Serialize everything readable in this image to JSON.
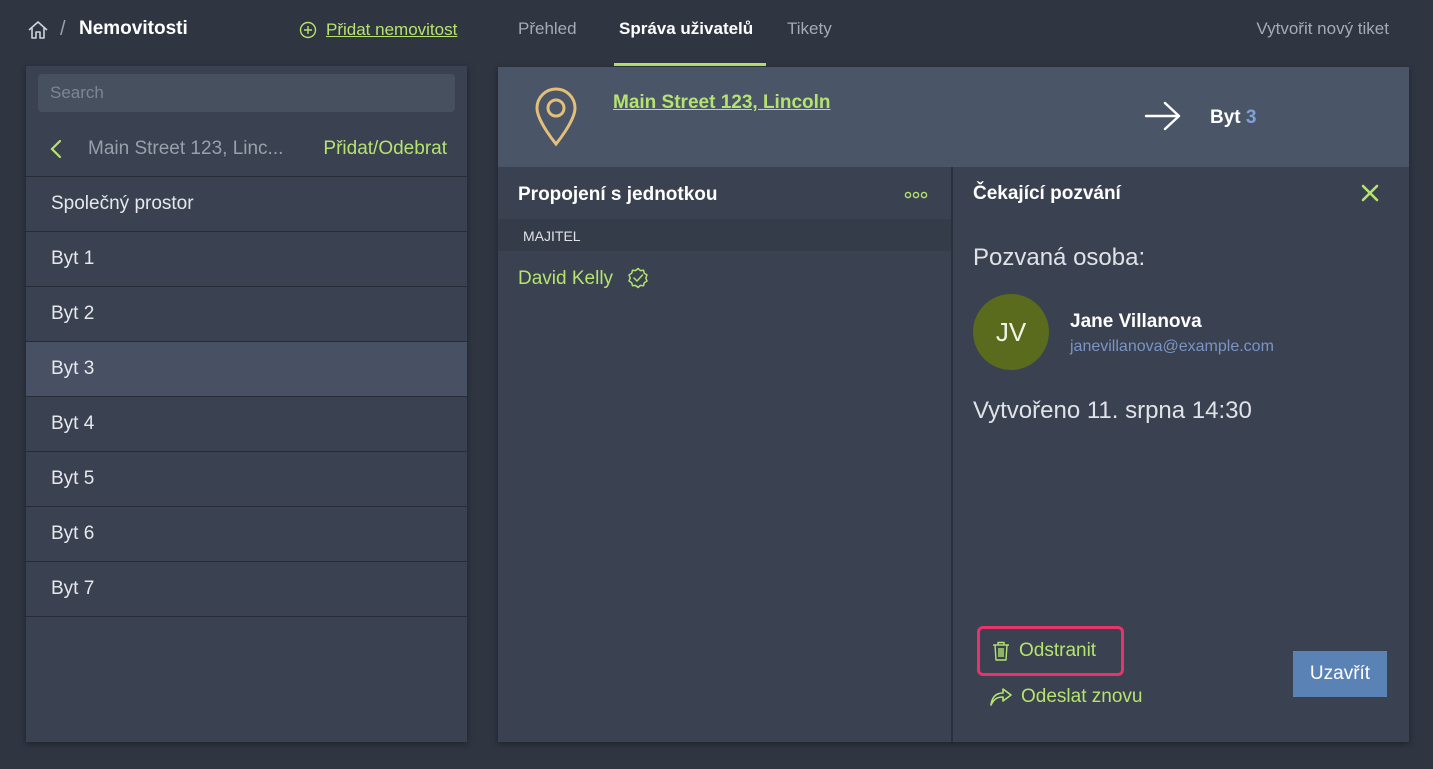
{
  "topbar": {
    "breadcrumb_separator": "/",
    "section_title": "Nemovitosti",
    "add_property_label": "Přidat nemovitost",
    "tabs": [
      {
        "label": "Přehled",
        "active": false
      },
      {
        "label": "Správa uživatelů",
        "active": true
      },
      {
        "label": "Tikety",
        "active": false
      }
    ],
    "new_ticket_label": "Vytvořit nový tiket"
  },
  "sidebar": {
    "search_placeholder": "Search",
    "address_truncated": "Main Street 123, Linc...",
    "add_remove_label": "Přidat/Odebrat",
    "units": [
      {
        "label": "Společný prostor",
        "selected": false
      },
      {
        "label": "Byt 1",
        "selected": false
      },
      {
        "label": "Byt 2",
        "selected": false
      },
      {
        "label": "Byt 3",
        "selected": true
      },
      {
        "label": "Byt 4",
        "selected": false
      },
      {
        "label": "Byt 5",
        "selected": false
      },
      {
        "label": "Byt 6",
        "selected": false
      },
      {
        "label": "Byt 7",
        "selected": false
      }
    ]
  },
  "main": {
    "address": "Main Street 123, Lincoln",
    "unit_word": "Byt",
    "unit_number": "3",
    "connection": {
      "title": "Propojení s jednotkou",
      "owner_section_label": "MAJITEL",
      "owner_name": "David Kelly"
    },
    "invite": {
      "title": "Čekající pozvání",
      "invited_label": "Pozvaná osoba:",
      "avatar_initials": "JV",
      "name": "Jane Villanova",
      "email": "janevillanova@example.com",
      "created": "Vytvořeno 11. srpna 14:30",
      "remove_label": "Odstranit",
      "resend_label": "Odeslat znovu",
      "close_label": "Uzavřít"
    }
  },
  "colors": {
    "accent_green": "#b6e36f",
    "highlight_pink": "#e8336d",
    "button_blue": "#5b82b5",
    "avatar_olive": "#5a6b1d",
    "pin_gold": "#e3bf7a"
  }
}
